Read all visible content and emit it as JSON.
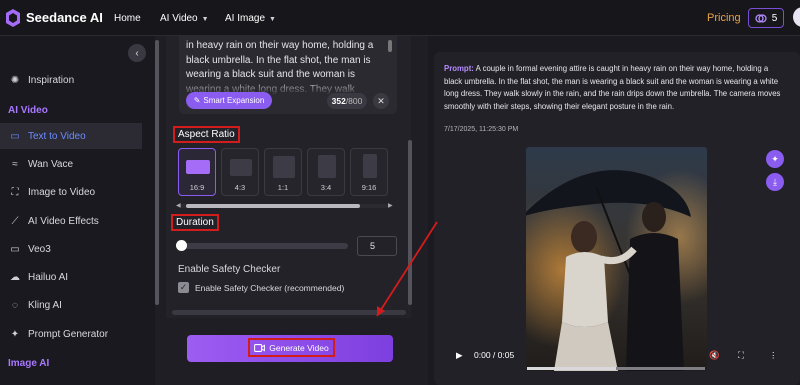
{
  "app": {
    "name": "Seedance AI"
  },
  "topnav": {
    "home": "Home",
    "ai_video": "AI Video",
    "ai_image": "AI Image",
    "pricing": "Pricing",
    "credits": "5"
  },
  "sidebar": {
    "inspiration": "Inspiration",
    "section_video": "AI Video",
    "items": [
      {
        "label": "Text to Video",
        "icon": "video-camera-icon",
        "active": true
      },
      {
        "label": "Wan Vace",
        "icon": "wave-icon"
      },
      {
        "label": "Image to Video",
        "icon": "expand-icon"
      },
      {
        "label": "AI Video Effects",
        "icon": "magic-wand-icon"
      },
      {
        "label": "Veo3",
        "icon": "video-camera-icon"
      },
      {
        "label": "Hailuo AI",
        "icon": "cloud-icon"
      },
      {
        "label": "Kling AI",
        "icon": "chat-bubble-icon"
      },
      {
        "label": "Prompt Generator",
        "icon": "sparkle-icon"
      }
    ],
    "section_image": "Image AI"
  },
  "prompt": {
    "text": "in heavy rain on their way home, holding a black umbrella. In the flat shot, the man is wearing a black suit and the woman is wearing a white long dress. They walk",
    "smart_expansion": "Smart Expansion",
    "count": "352",
    "max": "/800"
  },
  "aspect_ratio": {
    "label": "Aspect Ratio",
    "selected": "16:9",
    "options": [
      "16:9",
      "4:3",
      "1:1",
      "3:4",
      "9:16"
    ]
  },
  "duration": {
    "label": "Duration",
    "value": "5"
  },
  "safety": {
    "title": "Enable Safety Checker",
    "checkbox_label": "Enable Safety Checker (recommended)",
    "checked": true
  },
  "generate_button": "Generate Video",
  "result": {
    "prompt_label": "Prompt:",
    "prompt_text": "A couple in formal evening attire is caught in heavy rain on their way home, holding a black umbrella. In the flat shot, the man is wearing a black suit and the woman is wearing a white long dress. They walk slowly in the rain, and the rain drips down the umbrella. The camera moves smoothly with their steps, showing their elegant posture in the rain.",
    "timestamp": "7/17/2025, 11:25:30 PM",
    "video_time": "0:00 / 0:05",
    "progress": 0.5
  },
  "colors": {
    "accent": "#8a5cf0",
    "active_link": "#6b8cff",
    "pricing": "#e9a24a",
    "annotation_red": "#d31c1c"
  }
}
